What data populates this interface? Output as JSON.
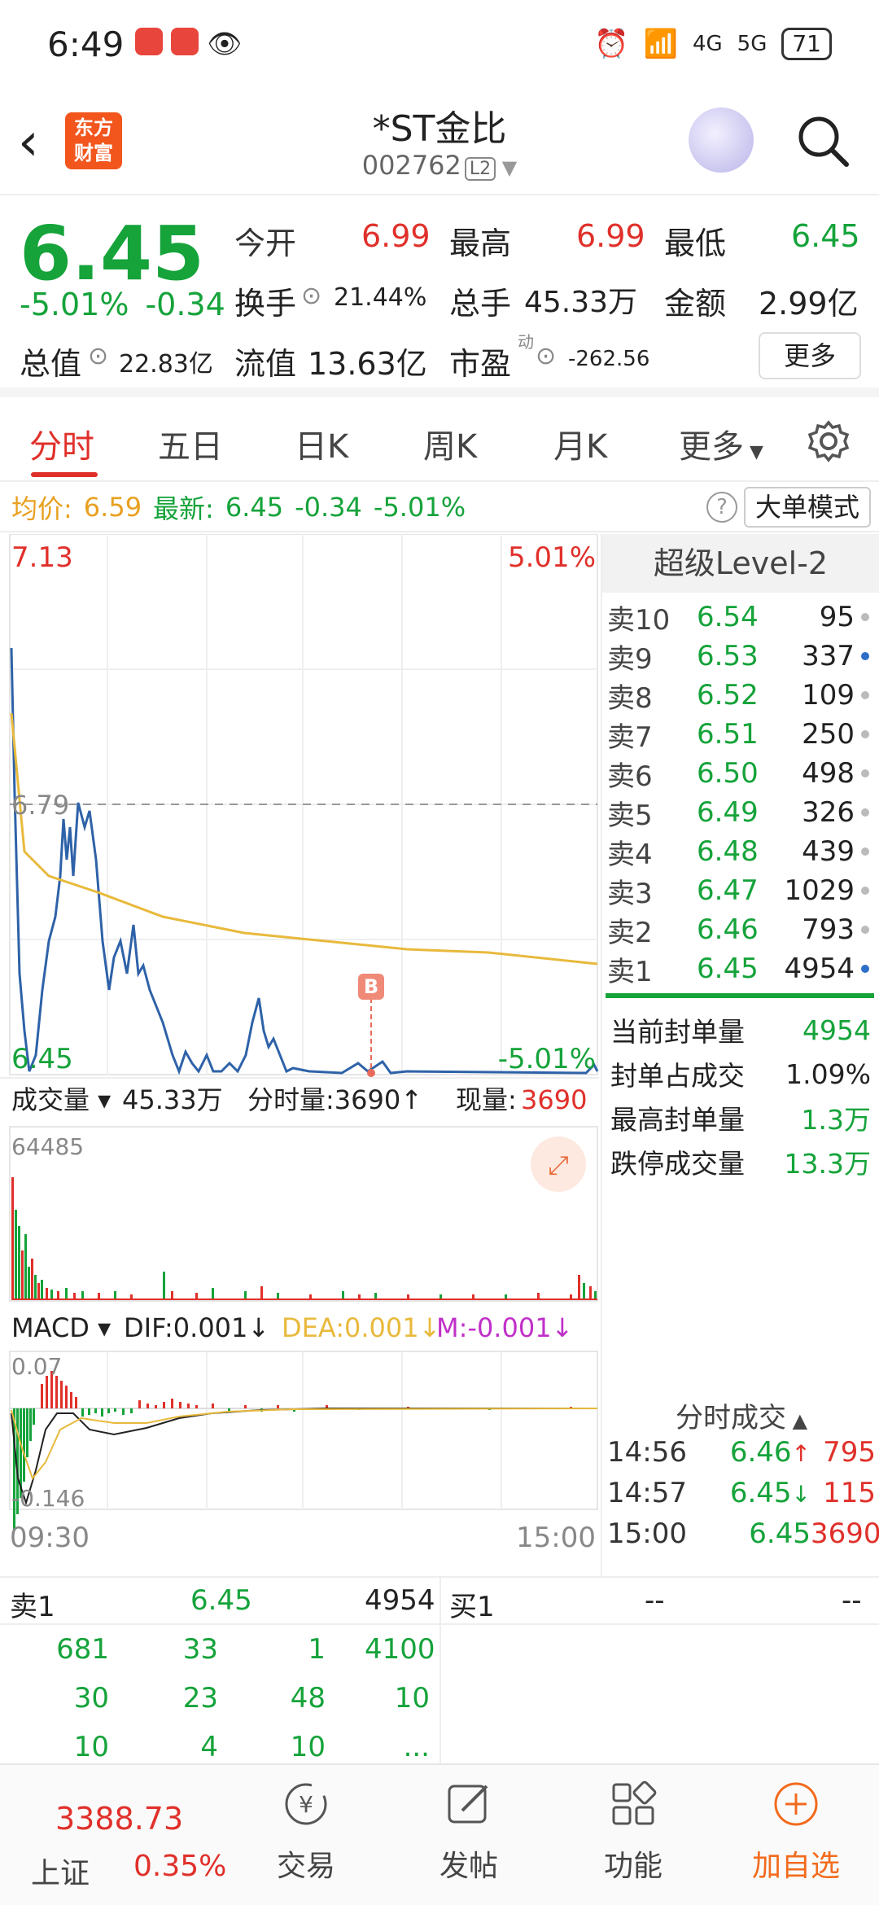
{
  "status_bar": {
    "time": "6:49",
    "battery": "71",
    "net1": "4G",
    "net2": "5G"
  },
  "header": {
    "title": "*ST金比",
    "code": "002762",
    "level_badge": "L2",
    "logo_text": "东方财富"
  },
  "quote": {
    "price": "6.45",
    "change_pct": "-5.01%",
    "change_abs": "-0.34",
    "open_label": "今开",
    "open": "6.99",
    "high_label": "最高",
    "high": "6.99",
    "low_label": "最低",
    "low": "6.45",
    "turnover_label": "换手",
    "turnover": "21.44%",
    "volume_label": "总手",
    "volume": "45.33万",
    "amount_label": "金额",
    "amount": "2.99亿",
    "mktcap_label": "总值",
    "mktcap": "22.83亿",
    "float_label": "流值",
    "float": "13.63亿",
    "pe_label": "市盈",
    "pe_sup": "动",
    "pe": "-262.56",
    "more_label": "更多"
  },
  "tabs": [
    "分时",
    "五日",
    "日K",
    "周K",
    "月K",
    "更多"
  ],
  "info_line": {
    "avg_label": "均价:",
    "avg": "6.59",
    "latest_label": "最新:",
    "latest": "6.45",
    "chg": "-0.34",
    "pct": "-5.01%",
    "mode_button": "大单模式"
  },
  "chart": {
    "top_price": "7.13",
    "top_pct": "5.01%",
    "mid_price": "6.79",
    "bottom_price": "6.45",
    "bottom_pct": "-5.01%",
    "marker": "B",
    "vol_label": "成交量",
    "vol_total": "45.33万",
    "vol_period_label": "分时量:3690",
    "now_label": "现量:",
    "now_val": "3690",
    "vol_max": "64485",
    "macd_label": "MACD",
    "dif": "DIF:0.001",
    "dea": "DEA:0.001",
    "m": "M:-0.001",
    "macd_top": "0.07",
    "macd_bottom": "-0.146",
    "time_start": "09:30",
    "time_end": "15:00",
    "colors": {
      "price_line": "#2e62a8",
      "avg_line": "#e8b93c",
      "up": "#e0302a",
      "down": "#15a33a"
    }
  },
  "depth": {
    "title": "超级Level-2",
    "asks": [
      {
        "label": "卖10",
        "price": "6.54",
        "vol": "95",
        "dot": "gray"
      },
      {
        "label": "卖9",
        "price": "6.53",
        "vol": "337",
        "dot": "blue"
      },
      {
        "label": "卖8",
        "price": "6.52",
        "vol": "109",
        "dot": "gray"
      },
      {
        "label": "卖7",
        "price": "6.51",
        "vol": "250",
        "dot": "gray"
      },
      {
        "label": "卖6",
        "price": "6.50",
        "vol": "498",
        "dot": "gray"
      },
      {
        "label": "卖5",
        "price": "6.49",
        "vol": "326",
        "dot": "gray"
      },
      {
        "label": "卖4",
        "price": "6.48",
        "vol": "439",
        "dot": "gray"
      },
      {
        "label": "卖3",
        "price": "6.47",
        "vol": "1029",
        "dot": "gray"
      },
      {
        "label": "卖2",
        "price": "6.46",
        "vol": "793",
        "dot": "gray"
      },
      {
        "label": "卖1",
        "price": "6.45",
        "vol": "4954",
        "dot": "blue"
      }
    ],
    "seal": [
      {
        "label": "当前封单量",
        "value": "4954"
      },
      {
        "label": "封单占成交",
        "value": "1.09%"
      },
      {
        "label": "最高封单量",
        "value": "1.3万"
      },
      {
        "label": "跌停成交量",
        "value": "13.3万"
      }
    ],
    "ticks_title": "分时成交",
    "ticks": [
      {
        "time": "14:56",
        "price": "6.46",
        "arrow": "↑",
        "vol": "795"
      },
      {
        "time": "14:57",
        "price": "6.45",
        "arrow": "↓",
        "vol": "115"
      },
      {
        "time": "15:00",
        "price": "6.45",
        "arrow": "",
        "vol": "3690"
      }
    ]
  },
  "queue": {
    "left_label": "卖1",
    "left_price": "6.45",
    "left_vol": "4954",
    "right_label": "买1",
    "right_price": "--",
    "right_vol": "--",
    "cells": [
      "681",
      "33",
      "1",
      "4100",
      "30",
      "23",
      "48",
      "10",
      "10",
      "4",
      "10",
      "..."
    ]
  },
  "bottom_nav": {
    "index_value": "3388.73",
    "index_name": "上证",
    "index_pct": "0.35%",
    "items": [
      "交易",
      "发帖",
      "功能",
      "加自选"
    ]
  }
}
